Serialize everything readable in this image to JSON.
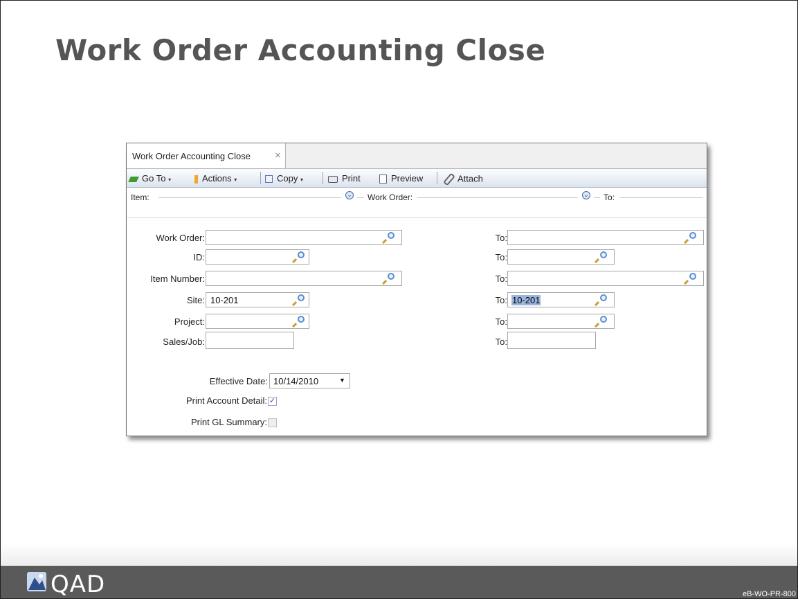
{
  "slide": {
    "title": "Work Order Accounting Close",
    "brand": "QAD",
    "course_code": "eB-WO-PR-800"
  },
  "window": {
    "tab_label": "Work Order Accounting Close",
    "tab_close": "×"
  },
  "toolbar": {
    "goto_label": "Go To",
    "actions_label": "Actions",
    "copy_label": "Copy",
    "print_label": "Print",
    "preview_label": "Preview",
    "attach_label": "Attach",
    "dropdown_caret": "▾"
  },
  "group_bar": {
    "item_label": "Item:",
    "work_order_label": "Work Order:",
    "to_label": "To:",
    "expand_glyph": "⌄"
  },
  "form": {
    "work_order": {
      "label": "Work Order:",
      "value": "",
      "to_label": "To:",
      "to_value": ""
    },
    "id": {
      "label": "ID:",
      "value": "",
      "to_label": "To:",
      "to_value": ""
    },
    "item_number": {
      "label": "Item Number:",
      "value": "",
      "to_label": "To:",
      "to_value": ""
    },
    "site": {
      "label": "Site:",
      "value": "10-201",
      "to_label": "To:",
      "to_value": "10-201"
    },
    "project": {
      "label": "Project:",
      "value": "",
      "to_label": "To:",
      "to_value": ""
    },
    "sales_job": {
      "label": "Sales/Job:",
      "value": "",
      "to_label": "To:",
      "to_value": ""
    },
    "effective_date": {
      "label": "Effective Date:",
      "value": "10/14/2010",
      "caret": "▼"
    },
    "print_account_detail": {
      "label": "Print Account Detail:",
      "checked": true,
      "mark": "✓"
    },
    "print_gl_summary": {
      "label": "Print GL Summary:",
      "checked": false
    }
  },
  "colors": {
    "accent": "#3e9b2f",
    "selection": "#9ab6de",
    "footer": "#5a5a5a"
  }
}
